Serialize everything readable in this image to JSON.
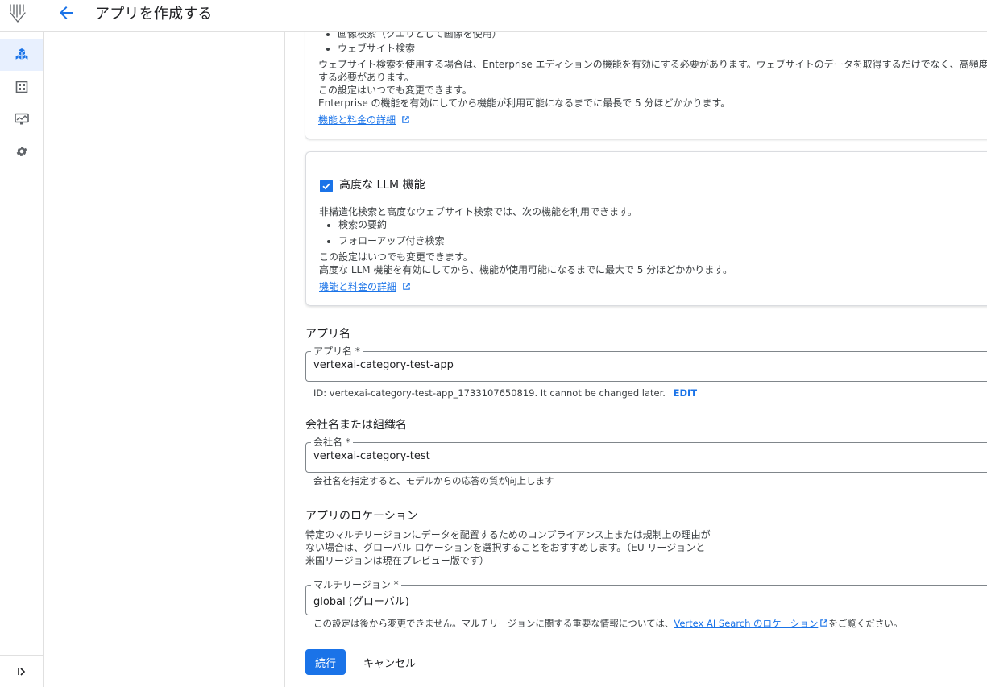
{
  "header": {
    "title": "アプリを作成する"
  },
  "top_card": {
    "bullets": [
      "画像検索（クエリとして画像を使用）",
      "ウェブサイト検索"
    ],
    "lines": [
      "ウェブサイト検索を使用する場合は、Enterprise エディションの機能を有効にする必要があります。ウェブサイトのデータを取得するだけでなく、高頻度の",
      "する必要があります。",
      "この設定はいつでも変更できます。",
      "Enterprise の機能を有効にしてから機能が利用可能になるまでに最長で 5 分ほどかかります。"
    ],
    "link": "機能と料金の詳細"
  },
  "llm_card": {
    "checked": true,
    "title": "高度な LLM 機能",
    "intro": "非構造化検索と高度なウェブサイト検索では、次の機能を利用できます。",
    "bullets": [
      "検索の要約",
      "フォローアップ付き検索"
    ],
    "line1": "この設定はいつでも変更できます。",
    "line2": "高度な LLM 機能を有効にしてから、機能が使用可能になるまでに最大で 5 分ほどかかります。",
    "link": "機能と料金の詳細"
  },
  "app_name": {
    "heading": "アプリ名",
    "label": "アプリ名 *",
    "value": "vertexai-category-test-app",
    "id_hint": "ID: vertexai-category-test-app_1733107650819. It cannot be changed later.",
    "edit": "EDIT"
  },
  "company": {
    "heading": "会社名または組織名",
    "label": "会社名 *",
    "value": "vertexai-category-test",
    "hint": "会社名を指定すると、モデルからの応答の質が向上します"
  },
  "location": {
    "heading": "アプリのロケーション",
    "desc": [
      "特定のマルチリージョンにデータを配置するためのコンプライアンス上または規制上の理由が",
      "ない場合は、グローバル ロケーションを選択することをおすすめします。（EU リージョンと",
      "米国リージョンは現在プレビュー版です）"
    ],
    "label": "マルチリージョン *",
    "value": "global (グローバル)",
    "hint_before": "この設定は後から変更できません。マルチリージョンに関する重要な情報については、",
    "hint_link": "Vertex AI Search のロケーション",
    "hint_after": "をご覧ください。"
  },
  "actions": {
    "continue": "続行",
    "cancel": "キャンセル"
  },
  "icons": {
    "logo": "agent-builder-logo-icon",
    "back": "arrow-back-icon",
    "rail": [
      "apps-icon",
      "data-stores-icon",
      "monitoring-icon",
      "settings-icon"
    ],
    "expand": "expand-rail-icon"
  },
  "colors": {
    "accent": "#1a73e8",
    "active_rail_bg": "#e8f0fe"
  }
}
